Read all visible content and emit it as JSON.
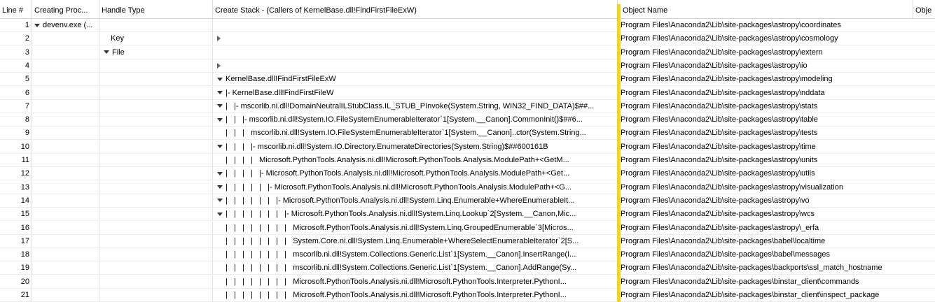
{
  "columns": {
    "line": "Line #",
    "process": "Creating Proc...",
    "handle_type": "Handle Type",
    "stack": "Create Stack - (Callers of KernelBase.dll!FindFirstFileExW)",
    "object_name": "Object Name",
    "extra": "Obje"
  },
  "rows": [
    {
      "line": "1",
      "proc": "devenv.exe (...",
      "type": "",
      "stack": "",
      "obj": "Program Files\\Anaconda2\\Lib\\site-packages\\astropy\\coordinates"
    },
    {
      "line": "2",
      "proc": "",
      "type": "Key",
      "stack": "",
      "obj": "Program Files\\Anaconda2\\Lib\\site-packages\\astropy\\cosmology"
    },
    {
      "line": "3",
      "proc": "",
      "type": "File",
      "stack": "",
      "obj": "Program Files\\Anaconda2\\Lib\\site-packages\\astropy\\extern"
    },
    {
      "line": "4",
      "proc": "",
      "type": "",
      "stack": "",
      "obj": "Program Files\\Anaconda2\\Lib\\site-packages\\astropy\\io"
    },
    {
      "line": "5",
      "proc": "",
      "type": "",
      "stack": "KernelBase.dll!FindFirstFileExW",
      "obj": "Program Files\\Anaconda2\\Lib\\site-packages\\astropy\\modeling"
    },
    {
      "line": "6",
      "proc": "",
      "type": "",
      "stack": "|- KernelBase.dll!FindFirstFileW",
      "obj": "Program Files\\Anaconda2\\Lib\\site-packages\\astropy\\nddata"
    },
    {
      "line": "7",
      "proc": "",
      "type": "",
      "stack": "|   |- mscorlib.ni.dll!DomainNeutralILStubClass.IL_STUB_PInvoke(System.String, WIN32_FIND_DATA)$##...",
      "obj": "Program Files\\Anaconda2\\Lib\\site-packages\\astropy\\stats"
    },
    {
      "line": "8",
      "proc": "",
      "type": "",
      "stack": "|   |   |- mscorlib.ni.dll!System.IO.FileSystemEnumerableIterator`1[System.__Canon].CommonInit()$##6...",
      "obj": "Program Files\\Anaconda2\\Lib\\site-packages\\astropy\\table"
    },
    {
      "line": "9",
      "proc": "",
      "type": "",
      "stack": "|   |   |   mscorlib.ni.dll!System.IO.FileSystemEnumerableIterator`1[System.__Canon]..ctor(System.String...",
      "obj": "Program Files\\Anaconda2\\Lib\\site-packages\\astropy\\tests"
    },
    {
      "line": "10",
      "proc": "",
      "type": "",
      "stack": "|   |   |   |- mscorlib.ni.dll!System.IO.Directory.EnumerateDirectories(System.String)$##600161B",
      "obj": "Program Files\\Anaconda2\\Lib\\site-packages\\astropy\\time"
    },
    {
      "line": "11",
      "proc": "",
      "type": "",
      "stack": "|   |   |   |   Microsoft.PythonTools.Analysis.ni.dll!Microsoft.PythonTools.Analysis.ModulePath+<GetM...",
      "obj": "Program Files\\Anaconda2\\Lib\\site-packages\\astropy\\units"
    },
    {
      "line": "12",
      "proc": "",
      "type": "",
      "stack": "|   |   |   |   |- Microsoft.PythonTools.Analysis.ni.dll!Microsoft.PythonTools.Analysis.ModulePath+<Get...",
      "obj": "Program Files\\Anaconda2\\Lib\\site-packages\\astropy\\utils"
    },
    {
      "line": "13",
      "proc": "",
      "type": "",
      "stack": "|   |   |   |   |   |- Microsoft.PythonTools.Analysis.ni.dll!Microsoft.PythonTools.Analysis.ModulePath+<G...",
      "obj": "Program Files\\Anaconda2\\Lib\\site-packages\\astropy\\visualization"
    },
    {
      "line": "14",
      "proc": "",
      "type": "",
      "stack": "|   |   |   |   |   |   |- Microsoft.PythonTools.Analysis.ni.dll!System.Linq.Enumerable+WhereEnumerableIt...",
      "obj": "Program Files\\Anaconda2\\Lib\\site-packages\\astropy\\vo"
    },
    {
      "line": "15",
      "proc": "",
      "type": "",
      "stack": "|   |   |   |   |   |   |   |- Microsoft.PythonTools.Analysis.ni.dll!System.Linq.Lookup`2[System.__Canon,Mic...",
      "obj": "Program Files\\Anaconda2\\Lib\\site-packages\\astropy\\wcs"
    },
    {
      "line": "16",
      "proc": "",
      "type": "",
      "stack": "|   |   |   |   |   |   |   |   Microsoft.PythonTools.Analysis.ni.dll!System.Linq.GroupedEnumerable`3[Micros...",
      "obj": "Program Files\\Anaconda2\\Lib\\site-packages\\astropy\\_erfa"
    },
    {
      "line": "17",
      "proc": "",
      "type": "",
      "stack": "|   |   |   |   |   |   |   |   System.Core.ni.dll!System.Linq.Enumerable+WhereSelectEnumerableIterator`2[S...",
      "obj": "Program Files\\Anaconda2\\Lib\\site-packages\\babel\\localtime"
    },
    {
      "line": "18",
      "proc": "",
      "type": "",
      "stack": "|   |   |   |   |   |   |   |   mscorlib.ni.dll!System.Collections.Generic.List`1[System.__Canon].InsertRange(I...",
      "obj": "Program Files\\Anaconda2\\Lib\\site-packages\\babel\\messages"
    },
    {
      "line": "19",
      "proc": "",
      "type": "",
      "stack": "|   |   |   |   |   |   |   |   mscorlib.ni.dll!System.Collections.Generic.List`1[System.__Canon].AddRange(Sy...",
      "obj": "Program Files\\Anaconda2\\Lib\\site-packages\\backports\\ssl_match_hostname"
    },
    {
      "line": "20",
      "proc": "",
      "type": "",
      "stack": "|   |   |   |   |   |   |   |   Microsoft.PythonTools.Analysis.ni.dll!Microsoft.PythonTools.Interpreter.PythonI...",
      "obj": "Program Files\\Anaconda2\\Lib\\site-packages\\binstar_client\\commands"
    },
    {
      "line": "21",
      "proc": "",
      "type": "",
      "stack": "|   |   |   |   |   |   |   |   Microsoft.PythonTools.Analysis.ni.dll!Microsoft.PythonTools.Interpreter.PythonI...",
      "obj": "Program Files\\Anaconda2\\Lib\\site-packages\\binstar_client\\inspect_package"
    }
  ]
}
